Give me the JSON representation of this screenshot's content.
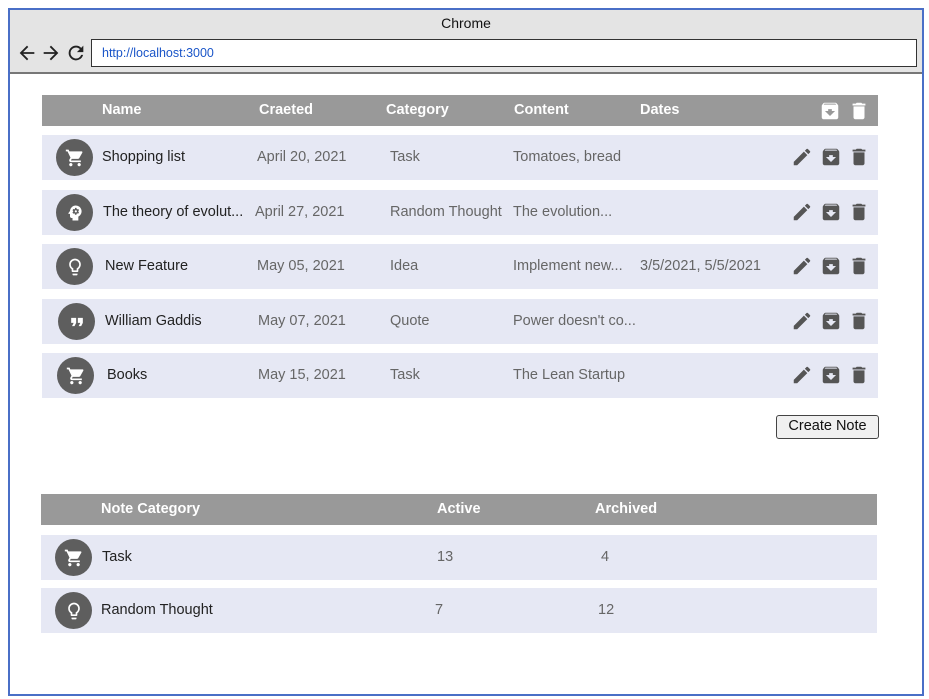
{
  "browser": {
    "title": "Chrome",
    "url": "http://localhost:3000"
  },
  "notes_table": {
    "headers": {
      "name": "Name",
      "created": "Craeted",
      "category": "Category",
      "content": "Content",
      "dates": "Dates"
    },
    "rows": [
      {
        "icon": "cart-icon",
        "name": "Shopping list",
        "created": "April 20, 2021",
        "category": "Task",
        "content": "Tomatoes, bread",
        "dates": ""
      },
      {
        "icon": "head-gear-icon",
        "name": "The theory of evolut...",
        "created": "April 27, 2021",
        "category": "Random Thought",
        "content": "The evolution...",
        "dates": ""
      },
      {
        "icon": "lightbulb-icon",
        "name": "New Feature",
        "created": "May 05, 2021",
        "category": "Idea",
        "content": "Implement new...",
        "dates": "3/5/2021, 5/5/2021"
      },
      {
        "icon": "quote-icon",
        "name": "William Gaddis",
        "created": "May 07, 2021",
        "category": "Quote",
        "content": "Power doesn't co...",
        "dates": ""
      },
      {
        "icon": "cart-icon",
        "name": "Books",
        "created": "May 15, 2021",
        "category": "Task",
        "content": "The Lean Startup",
        "dates": ""
      }
    ]
  },
  "create_button": {
    "label": "Create Note"
  },
  "summary_table": {
    "headers": {
      "category": "Note Category",
      "active": "Active",
      "archived": "Archived"
    },
    "rows": [
      {
        "icon": "cart-icon",
        "category": "Task",
        "active": "13",
        "archived": "4"
      },
      {
        "icon": "lightbulb-icon",
        "category": "Random Thought",
        "active": "7",
        "archived": "12"
      }
    ]
  }
}
